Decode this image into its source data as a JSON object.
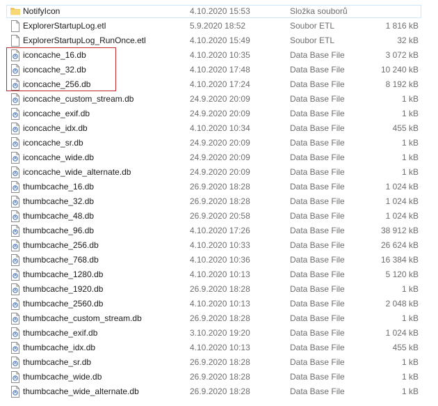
{
  "files": [
    {
      "name": "NotifyIcon",
      "date": "4.10.2020 15:53",
      "type": "Složka souborů",
      "size": "",
      "icon": "folder-icon",
      "selected": true
    },
    {
      "name": "ExplorerStartupLog.etl",
      "date": "5.9.2020 18:52",
      "type": "Soubor ETL",
      "size": "1 816 kB",
      "icon": "document-icon"
    },
    {
      "name": "ExplorerStartupLog_RunOnce.etl",
      "date": "4.10.2020 15:49",
      "type": "Soubor ETL",
      "size": "32 kB",
      "icon": "document-icon"
    },
    {
      "name": "iconcache_16.db",
      "date": "4.10.2020 10:35",
      "type": "Data Base File",
      "size": "3 072 kB",
      "icon": "database-file-icon"
    },
    {
      "name": "iconcache_32.db",
      "date": "4.10.2020 17:48",
      "type": "Data Base File",
      "size": "10 240 kB",
      "icon": "database-file-icon"
    },
    {
      "name": "iconcache_256.db",
      "date": "4.10.2020 17:24",
      "type": "Data Base File",
      "size": "8 192 kB",
      "icon": "database-file-icon"
    },
    {
      "name": "iconcache_custom_stream.db",
      "date": "24.9.2020 20:09",
      "type": "Data Base File",
      "size": "1 kB",
      "icon": "database-file-icon"
    },
    {
      "name": "iconcache_exif.db",
      "date": "24.9.2020 20:09",
      "type": "Data Base File",
      "size": "1 kB",
      "icon": "database-file-icon"
    },
    {
      "name": "iconcache_idx.db",
      "date": "4.10.2020 10:34",
      "type": "Data Base File",
      "size": "455 kB",
      "icon": "database-file-icon"
    },
    {
      "name": "iconcache_sr.db",
      "date": "24.9.2020 20:09",
      "type": "Data Base File",
      "size": "1 kB",
      "icon": "database-file-icon"
    },
    {
      "name": "iconcache_wide.db",
      "date": "24.9.2020 20:09",
      "type": "Data Base File",
      "size": "1 kB",
      "icon": "database-file-icon"
    },
    {
      "name": "iconcache_wide_alternate.db",
      "date": "24.9.2020 20:09",
      "type": "Data Base File",
      "size": "1 kB",
      "icon": "database-file-icon"
    },
    {
      "name": "thumbcache_16.db",
      "date": "26.9.2020 18:28",
      "type": "Data Base File",
      "size": "1 024 kB",
      "icon": "database-file-icon"
    },
    {
      "name": "thumbcache_32.db",
      "date": "26.9.2020 18:28",
      "type": "Data Base File",
      "size": "1 024 kB",
      "icon": "database-file-icon"
    },
    {
      "name": "thumbcache_48.db",
      "date": "26.9.2020 20:58",
      "type": "Data Base File",
      "size": "1 024 kB",
      "icon": "database-file-icon"
    },
    {
      "name": "thumbcache_96.db",
      "date": "4.10.2020 17:26",
      "type": "Data Base File",
      "size": "38 912 kB",
      "icon": "database-file-icon"
    },
    {
      "name": "thumbcache_256.db",
      "date": "4.10.2020 10:33",
      "type": "Data Base File",
      "size": "26 624 kB",
      "icon": "database-file-icon"
    },
    {
      "name": "thumbcache_768.db",
      "date": "4.10.2020 10:36",
      "type": "Data Base File",
      "size": "16 384 kB",
      "icon": "database-file-icon"
    },
    {
      "name": "thumbcache_1280.db",
      "date": "4.10.2020 10:13",
      "type": "Data Base File",
      "size": "5 120 kB",
      "icon": "database-file-icon"
    },
    {
      "name": "thumbcache_1920.db",
      "date": "26.9.2020 18:28",
      "type": "Data Base File",
      "size": "1 kB",
      "icon": "database-file-icon"
    },
    {
      "name": "thumbcache_2560.db",
      "date": "4.10.2020 10:13",
      "type": "Data Base File",
      "size": "2 048 kB",
      "icon": "database-file-icon"
    },
    {
      "name": "thumbcache_custom_stream.db",
      "date": "26.9.2020 18:28",
      "type": "Data Base File",
      "size": "1 kB",
      "icon": "database-file-icon"
    },
    {
      "name": "thumbcache_exif.db",
      "date": "3.10.2020 19:20",
      "type": "Data Base File",
      "size": "1 024 kB",
      "icon": "database-file-icon"
    },
    {
      "name": "thumbcache_idx.db",
      "date": "4.10.2020 10:13",
      "type": "Data Base File",
      "size": "455 kB",
      "icon": "database-file-icon"
    },
    {
      "name": "thumbcache_sr.db",
      "date": "26.9.2020 18:28",
      "type": "Data Base File",
      "size": "1 kB",
      "icon": "database-file-icon"
    },
    {
      "name": "thumbcache_wide.db",
      "date": "26.9.2020 18:28",
      "type": "Data Base File",
      "size": "1 kB",
      "icon": "database-file-icon"
    },
    {
      "name": "thumbcache_wide_alternate.db",
      "date": "26.9.2020 18:28",
      "type": "Data Base File",
      "size": "1 kB",
      "icon": "database-file-icon"
    }
  ],
  "colors": {
    "highlight_border": "#c0272d",
    "selection_border": "#cce8ff",
    "folder_yellow": "#f8d775",
    "secondary_text": "#6d6d6d"
  }
}
